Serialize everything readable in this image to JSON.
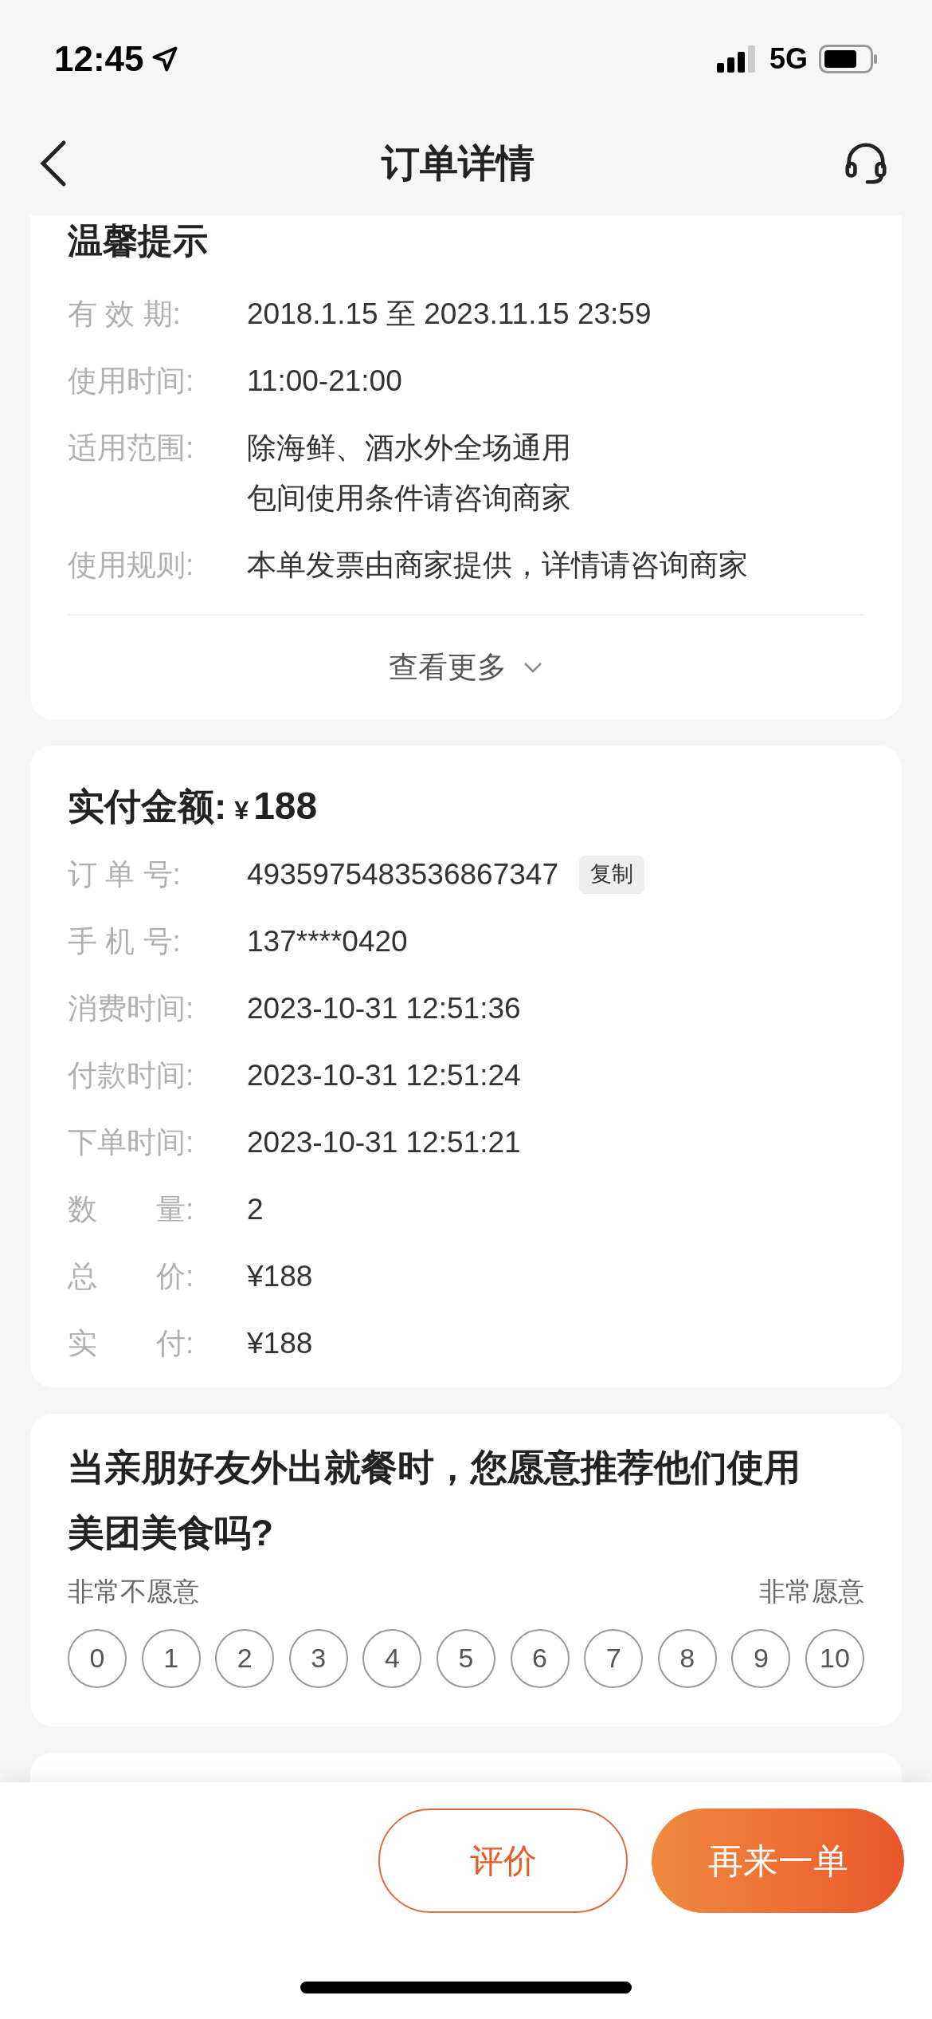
{
  "status_bar": {
    "time": "12:45",
    "network": "5G"
  },
  "nav": {
    "title": "订单详情"
  },
  "tips_card": {
    "title": "温馨提示",
    "rows": [
      {
        "label": "有 效 期:",
        "lines": [
          "2018.1.15 至 2023.11.15 23:59"
        ]
      },
      {
        "label": "使用时间:",
        "lines": [
          "11:00-21:00"
        ]
      },
      {
        "label": "适用范围:",
        "lines": [
          "除海鲜、酒水外全场通用",
          "包间使用条件请咨询商家"
        ]
      },
      {
        "label": "使用规则:",
        "lines": [
          "本单发票由商家提供，详情请咨询商家"
        ]
      }
    ],
    "more": "查看更多"
  },
  "payment_card": {
    "title": "实付金额:",
    "currency": "¥",
    "amount": "188",
    "rows": [
      {
        "label": "订 单 号:",
        "value": "4935975483536867347",
        "action": "复制"
      },
      {
        "label": "手 机 号:",
        "value": "137****0420"
      },
      {
        "label": "消费时间:",
        "value": "2023-10-31 12:51:36"
      },
      {
        "label": "付款时间:",
        "value": "2023-10-31 12:51:24"
      },
      {
        "label": "下单时间:",
        "value": "2023-10-31 12:51:21"
      },
      {
        "label": "数　　量:",
        "value": "2"
      },
      {
        "label": "总　　价:",
        "value": "¥188"
      },
      {
        "label": "实　　付:",
        "value": "¥188"
      }
    ]
  },
  "survey": {
    "question": "当亲朋好友外出就餐时，您愿意推荐他们使用美团美食吗?",
    "low_label": "非常不愿意",
    "high_label": "非常愿意",
    "scores": [
      {
        "label": "0",
        "selected": false
      },
      {
        "label": "1",
        "selected": false
      },
      {
        "label": "2",
        "selected": false
      },
      {
        "label": "3",
        "selected": false
      },
      {
        "label": "4",
        "selected": false
      },
      {
        "label": "5",
        "selected": false
      },
      {
        "label": "6",
        "selected": false
      },
      {
        "label": "7",
        "selected": false
      },
      {
        "label": "8",
        "selected": false
      },
      {
        "label": "9",
        "selected": false
      },
      {
        "label": "10",
        "selected": false
      }
    ]
  },
  "footer": {
    "buttons": [
      {
        "label": "评价",
        "kind": "outline"
      },
      {
        "label": "再来一单",
        "kind": "primary"
      }
    ]
  }
}
